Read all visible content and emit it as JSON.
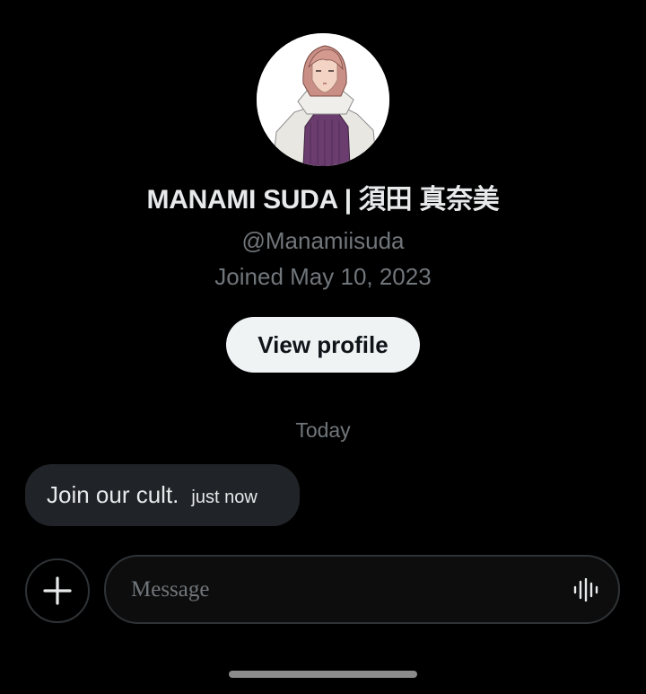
{
  "profile": {
    "display_name": "MANAMI SUDA | 須田 真奈美",
    "handle": "@Manamiisuda",
    "joined": "Joined May 10, 2023",
    "view_profile_label": "View profile"
  },
  "conversation": {
    "day_label": "Today",
    "messages": [
      {
        "text": "Join our cult.",
        "time": "just now"
      }
    ]
  },
  "composer": {
    "placeholder": "Message",
    "value": ""
  },
  "icons": {
    "add": "plus-icon",
    "voice": "voice-waveform-icon"
  },
  "colors": {
    "background": "#000000",
    "primary_text": "#e7e9ea",
    "secondary_text": "#71767b",
    "bubble": "#202327",
    "button_bg": "#eff3f4"
  }
}
